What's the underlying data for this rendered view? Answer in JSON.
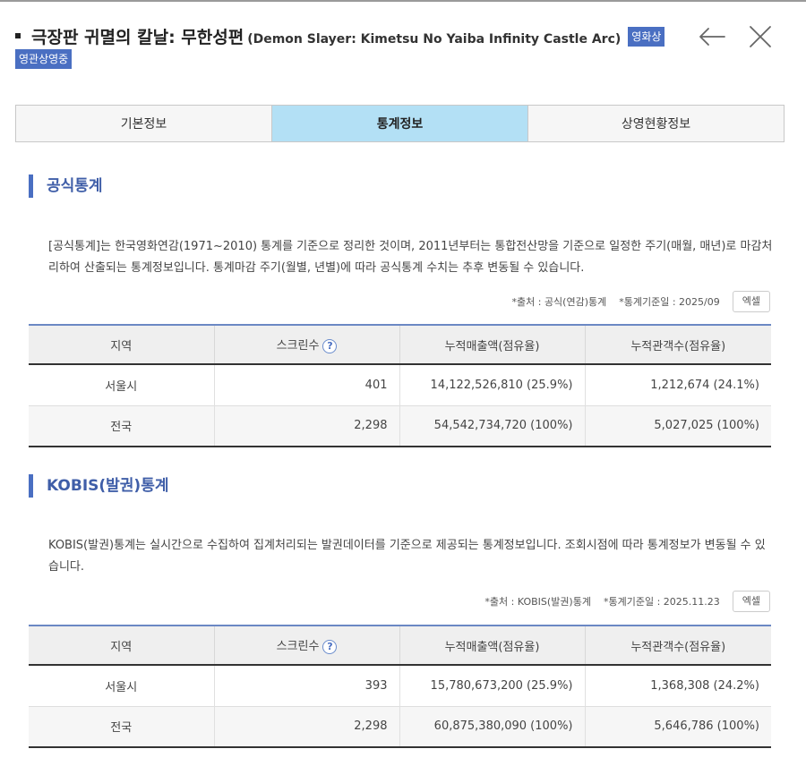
{
  "header": {
    "title": "극장판 귀멸의 칼날: 무한성편",
    "subtitle": "(Demon Slayer: Kimetsu No Yaiba Infinity Castle Arc)",
    "badge_a": "영화상",
    "badge_b": "영관상영중"
  },
  "tabs": [
    {
      "label": "기본정보",
      "active": false
    },
    {
      "label": "통계정보",
      "active": true
    },
    {
      "label": "상영현황정보",
      "active": false
    }
  ],
  "official": {
    "title": "공식통계",
    "description": "[공식통계]는 한국영화연감(1971~2010) 통계를 기준으로 정리한 것이며, 2011년부터는 통합전산망을 기준으로 일정한 주기(매월, 매년)로 마감처리하여 산출되는 통계정보입니다. 통계마감 주기(월별, 년별)에 따라 공식통계 수치는 추후 변동될 수 있습니다.",
    "source": "*출처 : 공식(연감)통계",
    "base_date": "*통계기준일 : 2025/09",
    "excel_label": "엑셀",
    "columns": [
      "지역",
      "스크린수",
      "누적매출액(점유율)",
      "누적관객수(점유율)"
    ],
    "rows": [
      [
        "서울시",
        "401",
        "14,122,526,810 (25.9%)",
        "1,212,674 (24.1%)"
      ],
      [
        "전국",
        "2,298",
        "54,542,734,720 (100%)",
        "5,027,025 (100%)"
      ]
    ]
  },
  "kobis": {
    "title": "KOBIS(발권)통계",
    "description": "KOBIS(발권)통계는 실시간으로 수집하여 집계처리되는 발권데이터를 기준으로 제공되는 통계정보입니다. 조회시점에 따라 통계정보가 변동될 수 있습니다.",
    "source": "*출처 : KOBIS(발권)통계",
    "base_date": "*통계기준일 : 2025.11.23",
    "excel_label": "엑셀",
    "columns": [
      "지역",
      "스크린수",
      "누적매출액(점유율)",
      "누적관객수(점유율)"
    ],
    "rows": [
      [
        "서울시",
        "393",
        "15,780,673,200 (25.9%)",
        "1,368,308 (24.2%)"
      ],
      [
        "전국",
        "2,298",
        "60,875,380,090 (100%)",
        "5,646,786 (100%)"
      ]
    ]
  },
  "help_glyph": "?",
  "icons": {
    "back": "arrow-left-icon",
    "close": "close-icon",
    "help": "question-icon",
    "bullet": "square-bullet-icon"
  },
  "colors": {
    "accent": "#4a6fc2",
    "active_tab": "#b3e0f5",
    "section_title": "#3f5ea8"
  }
}
